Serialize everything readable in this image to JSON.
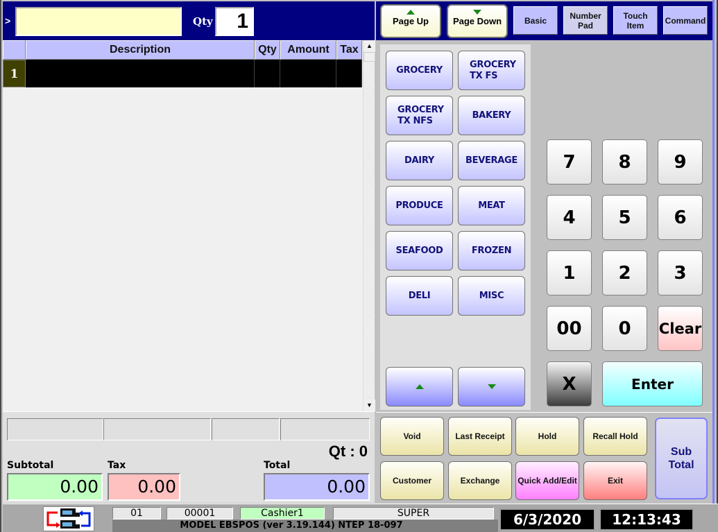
{
  "entry": {
    "prompt": ">",
    "scan_value": "",
    "qty_label": "Qty",
    "qty_value": "1"
  },
  "grid": {
    "headers": [
      "",
      "Description",
      "Qty",
      "Amount",
      "Tax"
    ],
    "rows": [
      {
        "num": "1",
        "description": "",
        "qty": "",
        "amount": "",
        "tax": ""
      }
    ]
  },
  "totals": {
    "qt_count": "Qt : 0",
    "subtotal_label": "Subtotal",
    "subtotal_value": "0.00",
    "tax_label": "Tax",
    "tax_value": "0.00",
    "total_label": "Total",
    "total_value": "0.00",
    "colors": {
      "subtotal": "#c0ffc0",
      "tax": "#ffc0c0",
      "total": "#c0c0ff"
    }
  },
  "nav": {
    "page_up": "Page Up",
    "page_down": "Page Down",
    "modes": [
      {
        "label": "Basic",
        "active": false
      },
      {
        "label": "Number\nPad",
        "active": true
      },
      {
        "label": "Touch\nItem",
        "active": false
      },
      {
        "label": "Command",
        "active": false
      }
    ]
  },
  "departments": [
    "GROCERY",
    "GROCERY\nTX FS",
    "GROCERY\nTX NFS",
    "BAKERY",
    "DAIRY",
    "BEVERAGE",
    "PRODUCE",
    "MEAT",
    "SEAFOOD",
    "FROZEN",
    "DELI",
    "MISC"
  ],
  "numpad": {
    "keys": [
      "7",
      "8",
      "9",
      "4",
      "5",
      "6",
      "1",
      "2",
      "3",
      "00",
      "0"
    ],
    "clear": "Clear",
    "multiply": "X",
    "enter": "Enter"
  },
  "functions": {
    "void": "Void",
    "last_receipt": "Last Receipt",
    "hold": "Hold",
    "recall_hold": "Recall Hold",
    "customer": "Customer",
    "exchange": "Exchange",
    "quick_add_edit": "Quick Add/Edit",
    "exit": "Exit",
    "subtotal": "Sub\nTotal"
  },
  "status": {
    "register": "01",
    "transaction": "00001",
    "cashier": "Cashier1",
    "role": "SUPER",
    "model": "MODEL EBSPOS (ver 3.19.144)   NTEP  18-097",
    "date": "6/3/2020",
    "time": "12:13:43 PM",
    "cashier_color": "#c0ffc0"
  }
}
